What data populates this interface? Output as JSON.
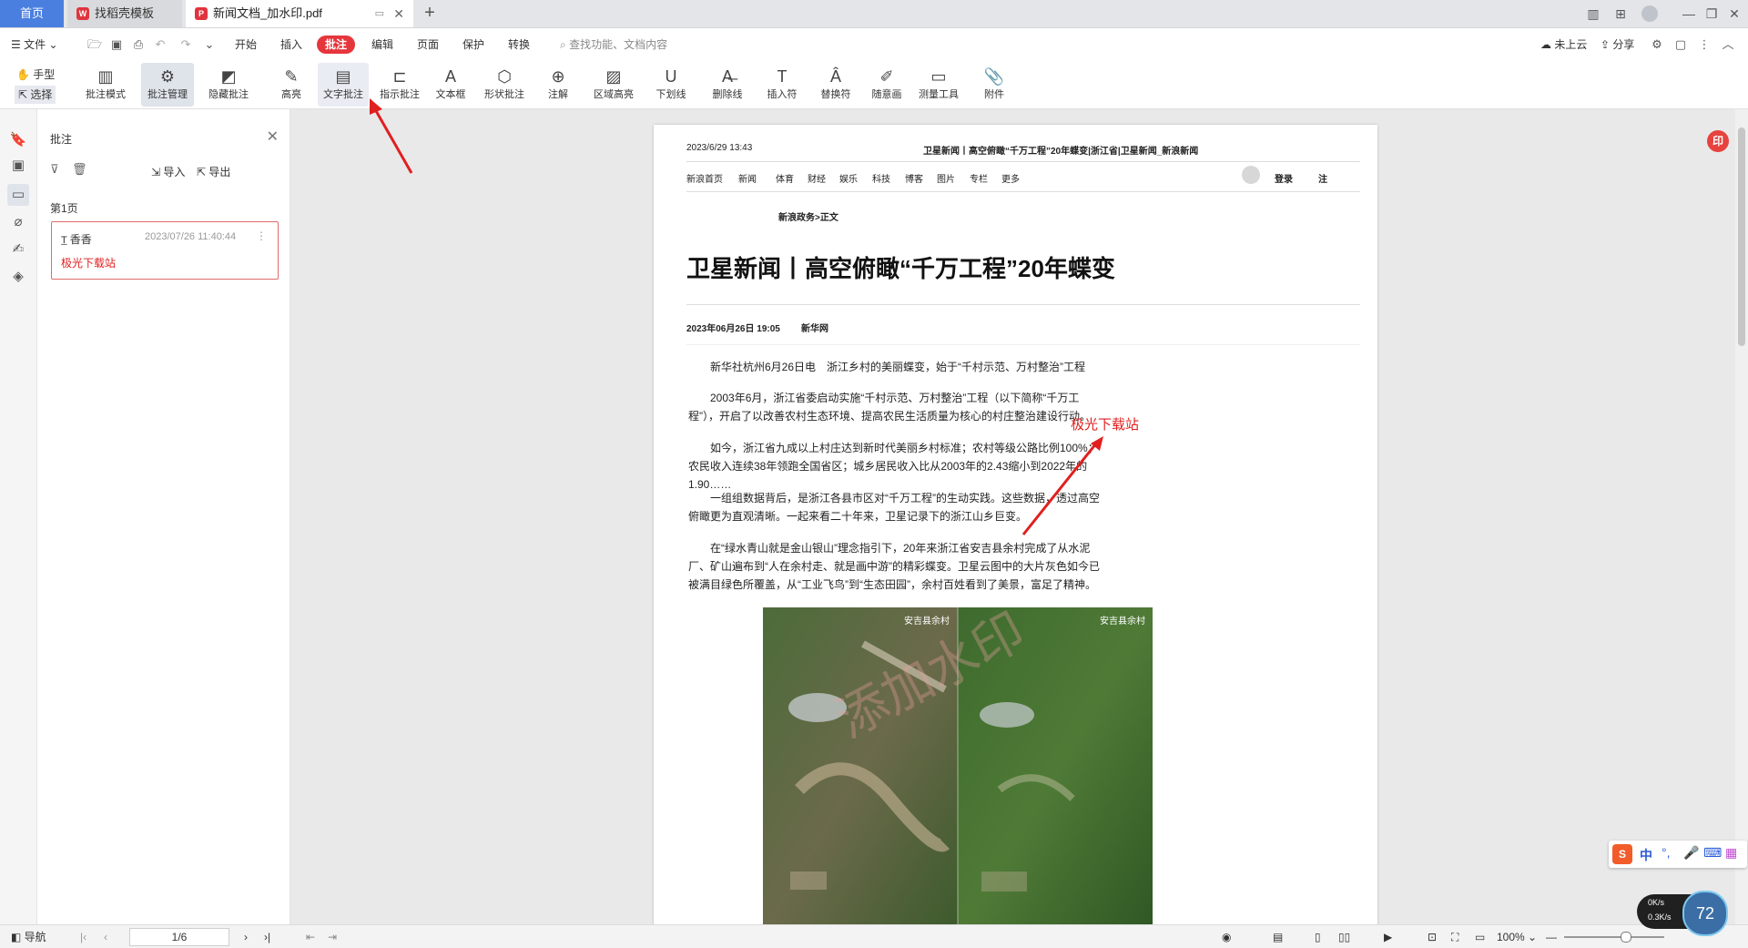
{
  "tabs": {
    "home": "首页",
    "template": "找稻壳模板",
    "document": "新闻文档_加水印.pdf",
    "doc_icon": "pdf-icon",
    "add": "+"
  },
  "menu": {
    "file": "文件",
    "items": [
      "开始",
      "插入",
      "批注",
      "编辑",
      "页面",
      "保护",
      "转换"
    ],
    "search": "查找功能、文档内容",
    "cloud": "未上云",
    "share": "分享"
  },
  "ribbon": {
    "hand": "手型",
    "select": "选择",
    "tools": [
      {
        "label": "批注模式",
        "icon": "annotation-mode-icon"
      },
      {
        "label": "批注管理",
        "icon": "annotation-manage-icon"
      },
      {
        "label": "隐藏批注",
        "icon": "hide-annotation-icon"
      },
      {
        "label": "高亮",
        "icon": "highlight-icon"
      },
      {
        "label": "文字批注",
        "icon": "text-annotation-icon"
      },
      {
        "label": "指示批注",
        "icon": "pointer-annotation-icon"
      },
      {
        "label": "文本框",
        "icon": "textbox-icon"
      },
      {
        "label": "形状批注",
        "icon": "shape-annotation-icon"
      },
      {
        "label": "注解",
        "icon": "note-icon"
      },
      {
        "label": "区域高亮",
        "icon": "area-highlight-icon"
      },
      {
        "label": "下划线",
        "icon": "underline-icon"
      },
      {
        "label": "删除线",
        "icon": "strikethrough-icon"
      },
      {
        "label": "插入符",
        "icon": "insert-caret-icon"
      },
      {
        "label": "替换符",
        "icon": "replace-caret-icon"
      },
      {
        "label": "随意画",
        "icon": "freehand-icon"
      },
      {
        "label": "测量工具",
        "icon": "ruler-icon"
      },
      {
        "label": "附件",
        "icon": "paperclip-icon"
      }
    ]
  },
  "panel": {
    "title": "批注",
    "import": "导入",
    "export": "导出",
    "page": "第1页",
    "card": {
      "author": "香香",
      "time": "2023/07/26 11:40:44",
      "text": "极光下载站"
    }
  },
  "document": {
    "header_time": "2023/6/29 13:43",
    "header_title": "卫星新闻丨高空俯瞰“千万工程”20年蝶变|浙江省|卫星新闻_新浪新闻",
    "nav": [
      "新浪首页",
      "新闻",
      "体育",
      "财经",
      "娱乐",
      "科技",
      "博客",
      "图片",
      "专栏",
      "更多"
    ],
    "login": "登录",
    "register": "注",
    "breadcrumb": "新浪政务>正文",
    "headline": "卫星新闻丨高空俯瞰“千万工程”20年蝶变",
    "date": "2023年06月26日 19:05",
    "source": "新华网",
    "paragraphs": [
      "新华社杭州6月26日电　浙江乡村的美丽蝶变，始于“千村示范、万村整治”工程",
      "2003年6月，浙江省委启动实施“千村示范、万村整治”工程（以下简称“千万工程”），开启了以改善农村生态环境、提高农民生活质量为核心的村庄整治建设行动。",
      "如今，浙江省九成以上村庄达到新时代美丽乡村标准；农村等级公路比例100%；农民收入连续38年领跑全国省区；城乡居民收入比从2003年的2.43缩小到2022年的1.90……",
      "一组组数据背后，是浙江各县市区对“千万工程”的生动实践。这些数据，透过高空俯瞰更为直观清晰。一起来看二十年来，卫星记录下的浙江山乡巨变。",
      "在“绿水青山就是金山银山”理念指引下，20年来浙江省安吉县余村完成了从水泥厂、矿山遍布到“人在余村走、就是画中游”的精彩蝶变。卫星云图中的大片灰色如今已被满目绿色所覆盖，从“工业飞鸟”到“生态田园”，余村百姓看到了美景，富足了精神。"
    ],
    "photo_left_label": "安吉县余村",
    "photo_right_label": "安吉县余村",
    "annotation_text": "极光下载站",
    "watermark": "添加水印"
  },
  "status": {
    "nav": "导航",
    "page": "1/6",
    "zoom": "100%"
  },
  "overlays": {
    "seal": "印",
    "ime": "中",
    "net_up": "0K/s",
    "net_down": "0.3K/s",
    "net_percent": "72"
  },
  "colors": {
    "accent_red": "#e5363c",
    "tab_blue": "#4a7fe0",
    "annotation_red": "#e02020"
  }
}
